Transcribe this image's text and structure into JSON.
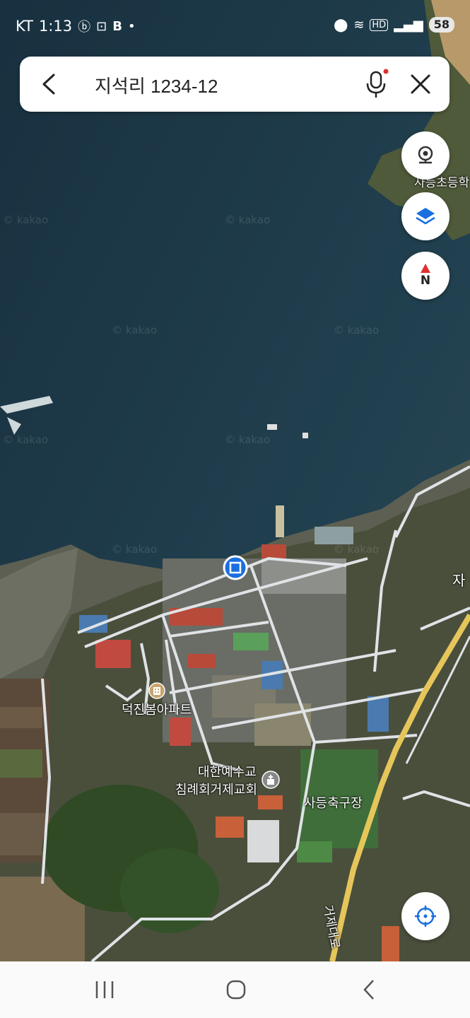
{
  "status_bar": {
    "carrier": "KT",
    "time": "1:13",
    "battery": "58",
    "hd_label": "HD"
  },
  "search": {
    "query": "지석리 1234-12"
  },
  "controls": {
    "street_view_icon": "street-view-icon",
    "layers_icon": "layers-icon",
    "compass_letter": "N",
    "my_location_icon": "crosshair-icon"
  },
  "map": {
    "watermark": "© kakao",
    "labels": {
      "apartment": "덕진봄아파트",
      "church_line1": "대한예수교",
      "church_line2": "침례회거제교회",
      "soccer_field": "사등축구장",
      "road": "거제대로",
      "school_partial": "사등초등학",
      "edge_partial": "자"
    }
  },
  "colors": {
    "sea": "#1f3a4a",
    "road_main": "#e6c65a",
    "road_minor": "#dfe3e6",
    "marker": "#1a6fe0",
    "compass_red": "#e03030"
  }
}
